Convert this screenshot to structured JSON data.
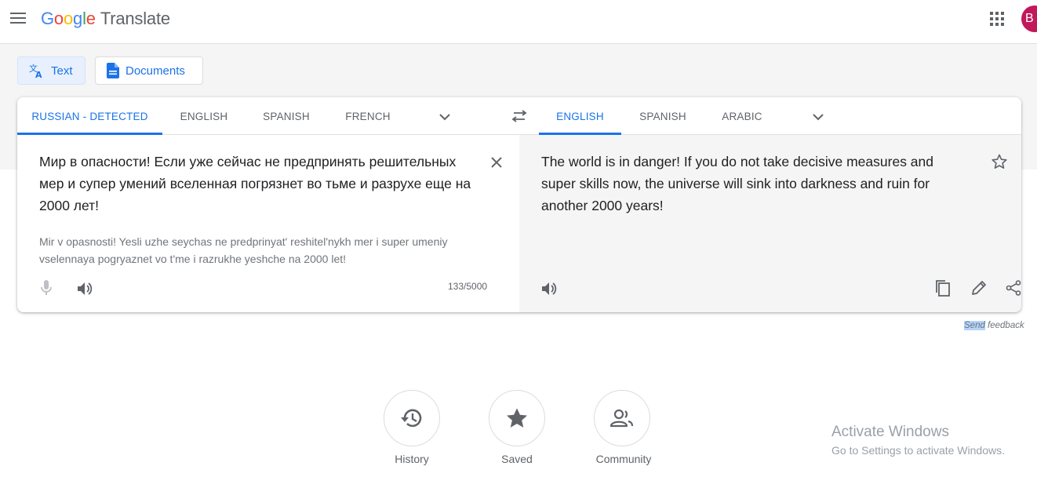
{
  "header": {
    "logo_letters": [
      "G",
      "o",
      "o",
      "g",
      "l",
      "e"
    ],
    "logo_colors": [
      "#4285f4",
      "#ea4335",
      "#fbbc05",
      "#4285f4",
      "#34a853",
      "#ea4335"
    ],
    "product": "Translate",
    "avatar_initial": "B",
    "avatar_color": "#c2185b"
  },
  "modes": {
    "text": "Text",
    "documents": "Documents"
  },
  "source_langs": [
    "RUSSIAN - DETECTED",
    "ENGLISH",
    "SPANISH",
    "FRENCH"
  ],
  "target_langs": [
    "ENGLISH",
    "SPANISH",
    "ARABIC"
  ],
  "source": {
    "text": "Мир в опасности! Если уже сейчас не предпринять решительных мер и супер умений вселенная погрязнет во тьме и разрухе еще на 2000 лет!",
    "transliteration": "Mir v opasnosti! Yesli uzhe seychas ne predprinyat' reshitel'nykh mer i super umeniy vselennaya pogryaznet vo t'me i razrukhe yeshche na 2000 let!",
    "char_count": "133/5000"
  },
  "target": {
    "text": "The world is in danger! If you do not take decisive measures and super skills now, the universe will sink into darkness and ruin for another 2000 years!"
  },
  "feedback": {
    "highlight": "Send",
    "rest": " feedback"
  },
  "bottom_buttons": {
    "history": "History",
    "saved": "Saved",
    "community": "Community"
  },
  "watermark": {
    "title": "Activate Windows",
    "subtitle": "Go to Settings to activate Windows."
  },
  "colors": {
    "accent": "#1a73e8"
  }
}
